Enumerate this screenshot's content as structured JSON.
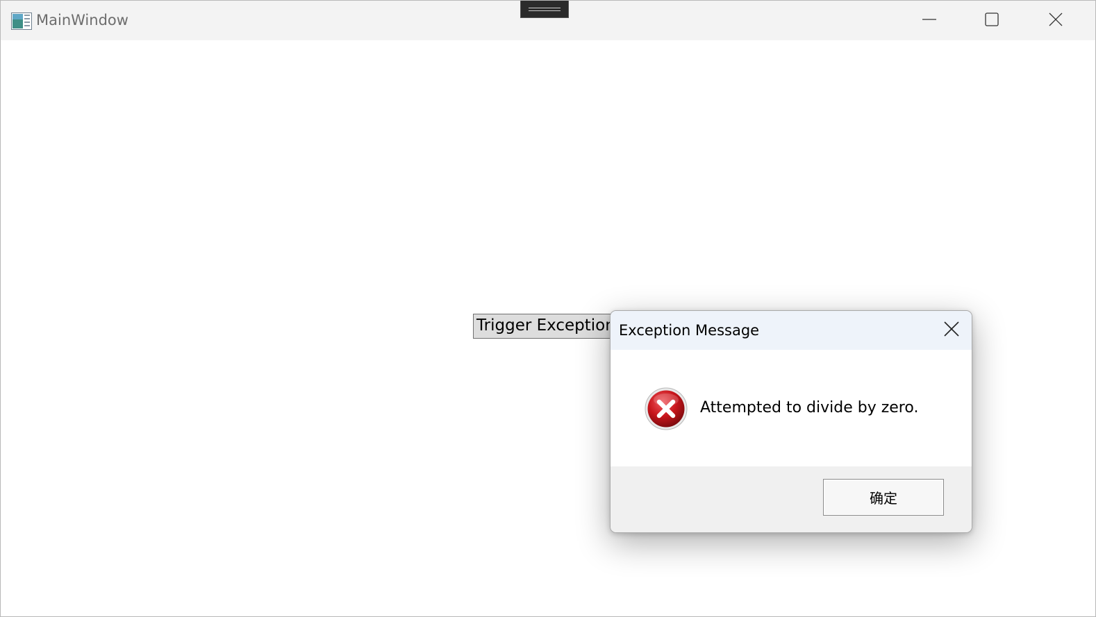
{
  "window": {
    "title": "MainWindow"
  },
  "main": {
    "trigger_button_label": "Trigger Exception"
  },
  "dialog": {
    "title": "Exception Message",
    "message": "Attempted to divide by zero.",
    "ok_label": "确定",
    "icon": "error-icon"
  },
  "colors": {
    "titlebar_bg": "#f3f3f3",
    "dialog_titlebar_bg": "#eef3fa",
    "dialog_footer_bg": "#f0f0f0",
    "error_red": "#c8151b"
  }
}
